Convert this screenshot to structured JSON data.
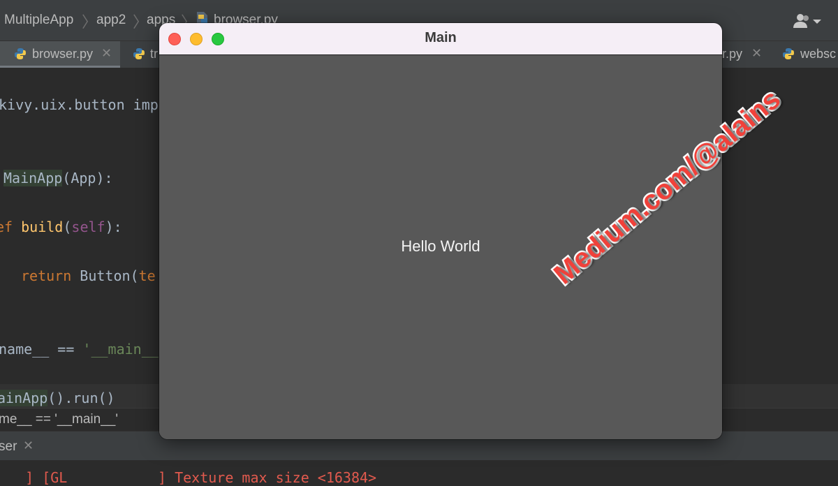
{
  "ide": {
    "breadcrumb": [
      "MultipleApp",
      "app2",
      "apps",
      "browser.py"
    ],
    "tabs": [
      {
        "label": "browser.py",
        "active": true
      },
      {
        "label": "tr",
        "active": false
      },
      {
        "label": "r.py",
        "active": false
      },
      {
        "label": "websc",
        "active": false
      }
    ],
    "code": {
      "line1": "kivy.uix.button imp",
      "line2_class": "MainApp",
      "line2_rest": "(App):",
      "line3_kw": "ef",
      "line3_fn": "build",
      "line3_self": "self",
      "line4_kw": "return",
      "line4_call": "Button(",
      "line4_partial": "te",
      "line5_name": "name__ == ",
      "line5_str": "'__main__",
      "line6_call": "ainApp",
      "line6_rest": "().run()"
    },
    "code_breadcrumb": "me__ == '__main__'",
    "run_tab": {
      "label": "ser"
    },
    "console": {
      "part1": "   ] [GL",
      "part2": "] Texture max size <16384>"
    },
    "accent_colors": {
      "keyword": "#cc7832",
      "function": "#ffc66d",
      "self": "#94558d",
      "string": "#6a8759",
      "error": "#e25a4e"
    }
  },
  "window": {
    "title": "Main",
    "button_text": "Hello World",
    "traffic_lights": [
      "close",
      "minimize",
      "zoom"
    ]
  },
  "watermark": "Medium.com/@alains"
}
